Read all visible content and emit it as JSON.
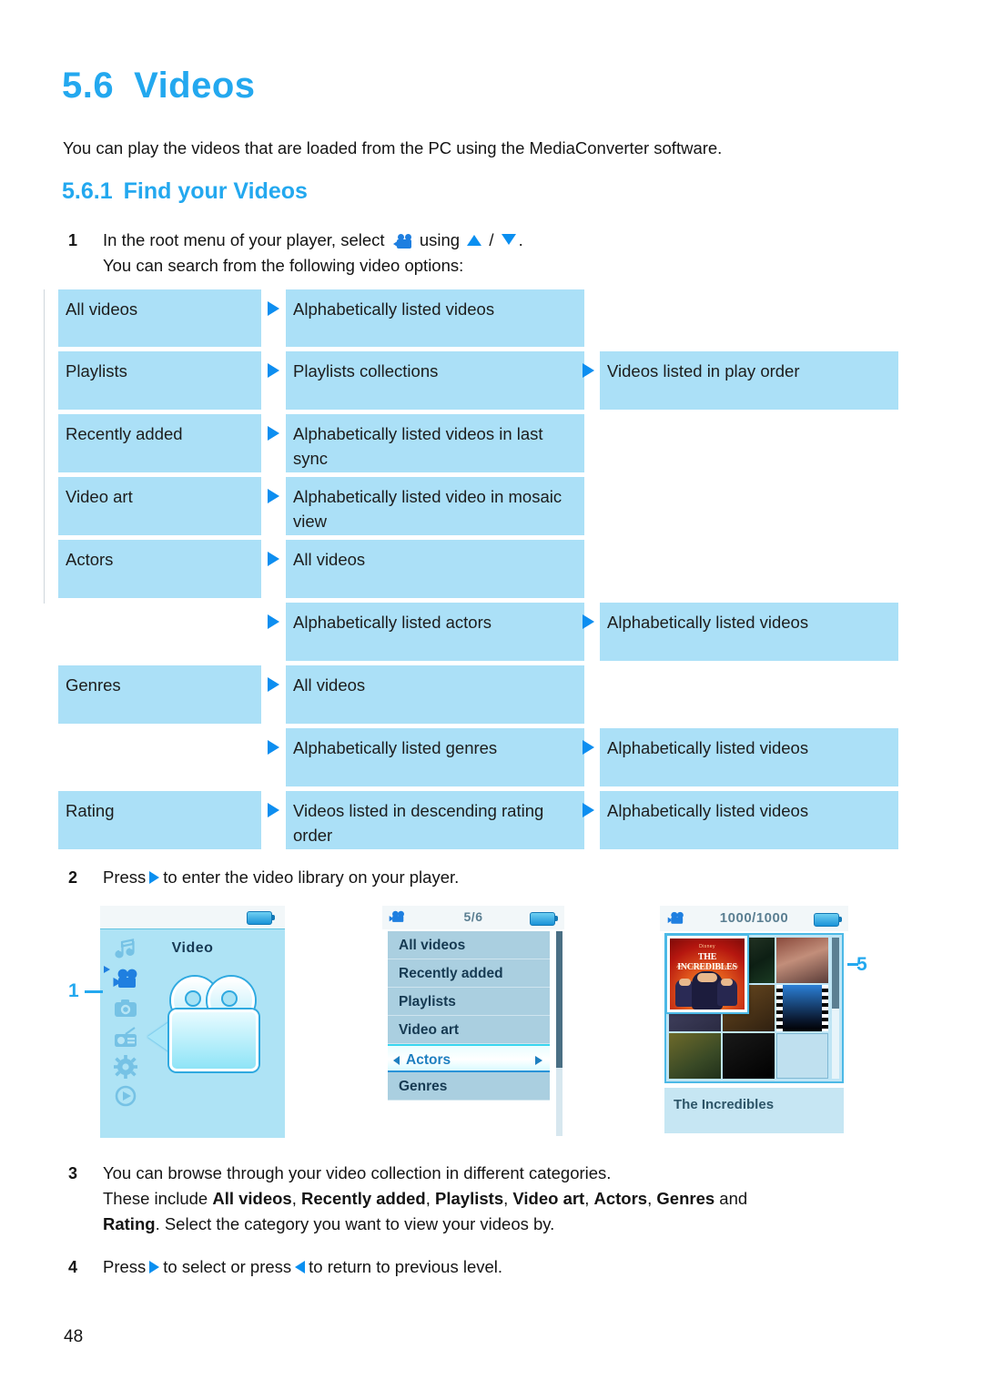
{
  "heading": {
    "section_number": "5.6",
    "section_title": "Videos",
    "intro": "You can play the videos that are loaded from the PC using the MediaConverter software.",
    "sub_number": "5.6.1",
    "sub_title": "Find your Videos"
  },
  "steps": {
    "s1_num": "1",
    "s1_text_a": "In the root menu of your player, select",
    "s1_text_b": "using",
    "s1_text_c": "/",
    "s1_text_d": ".",
    "s1_line2": "You can search from the following video options:",
    "s2_num": "2",
    "s2_text_a": "Press",
    "s2_text_b": "to enter the video library on your player.",
    "s3_num": "3",
    "s3_line1": "You can browse through your video collection in different categories.",
    "s3_line2_a": "These include",
    "s3_b1": "All videos",
    "s3_sep1": ",",
    "s3_b2": "Recently added",
    "s3_sep2": ",",
    "s3_b3": "Playlists",
    "s3_sep3": ",",
    "s3_b4": "Video art",
    "s3_sep4": ",",
    "s3_b5": "Actors",
    "s3_sep5": ",",
    "s3_b6": "Genres",
    "s3_and": "and",
    "s3_b7": "Rating",
    "s3_line3_b": ". Select the category you want to view your videos by.",
    "s4_num": "4",
    "s4_text_a": "Press",
    "s4_text_b": "to select or press",
    "s4_text_c": "to return to previous level."
  },
  "table": {
    "rows": [
      {
        "c1": "All videos",
        "c2": "Alphabetically listed videos",
        "c3": ""
      },
      {
        "c1": "Playlists",
        "c2": "Playlists collections",
        "c3": "Videos listed in play order"
      },
      {
        "c1": "Recently added",
        "c2": "Alphabetically listed videos in last sync",
        "c3": ""
      },
      {
        "c1": "Video art",
        "c2": "Alphabetically listed video in mosaic view",
        "c3": ""
      },
      {
        "c1": "Actors",
        "c2": "All videos",
        "c3": ""
      },
      {
        "c1": "",
        "c2": "Alphabetically listed actors",
        "c3": "Alphabetically listed videos"
      },
      {
        "c1": "Genres",
        "c2": "All videos",
        "c3": ""
      },
      {
        "c1": "",
        "c2": "Alphabetically listed genres",
        "c3": "Alphabetically listed videos"
      },
      {
        "c1": "Rating",
        "c2": "Videos listed in descending rating order",
        "c3": "Alphabetically listed videos"
      }
    ]
  },
  "screenshots": {
    "shot1": {
      "title": "Video",
      "sidebar_icons": [
        "music-note-icon",
        "video-camera-icon",
        "camera-icon",
        "radio-icon",
        "gear-icon",
        "play-circle-icon"
      ],
      "battery": "battery-icon",
      "callout": "1"
    },
    "shot2": {
      "header_icon": "video-camera-icon",
      "counter": "5/6",
      "battery": "battery-icon",
      "items": [
        "All videos",
        "Recently added",
        "Playlists",
        "Video art",
        "Actors",
        "Genres"
      ],
      "selected": "Actors"
    },
    "shot3": {
      "header_icon": "video-camera-icon",
      "counter": "1000/1000",
      "battery": "battery-icon",
      "caption": "The Incredibles",
      "selected_thumb_title": "THE INCREDIBLES",
      "callout": "5"
    }
  },
  "footer": {
    "page_number": "48"
  },
  "colors": {
    "accent_blue": "#23a8ef",
    "arrow_blue": "#0d8ef0",
    "cell_blue": "#abe0f7",
    "text": "#1a1a1a"
  }
}
